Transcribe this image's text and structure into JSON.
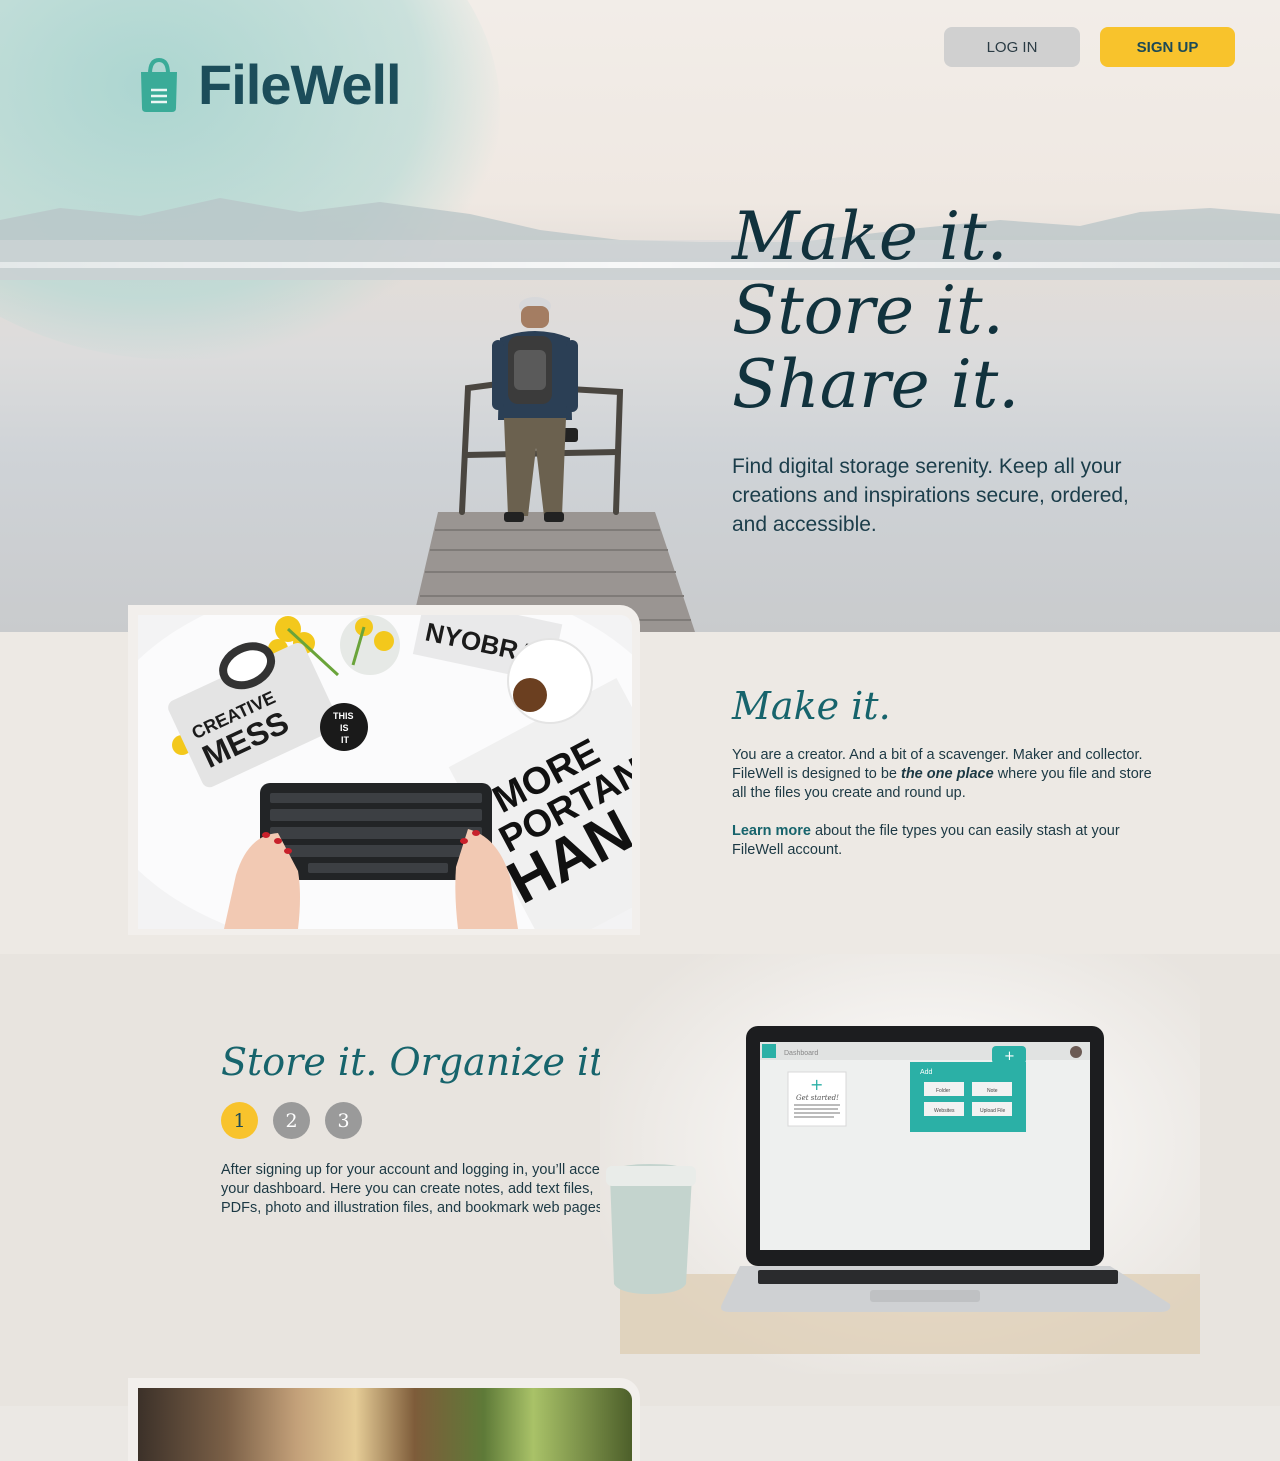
{
  "header": {
    "brand": "FileWell",
    "login_label": "LOG IN",
    "signup_label": "SIGN UP"
  },
  "hero": {
    "tagline": [
      "Make it.",
      "Store it.",
      "Share it."
    ],
    "subtitle": "Find digital storage serenity. Keep all your creations and inspirations secure, ordered, and accessible."
  },
  "make_section": {
    "heading": "Make it.",
    "para1_a": "You are a creator. And a bit of a scavenger. Maker and collector. FileWell is designed to be ",
    "para1_em": "the one place",
    "para1_b": " where you file and store all the files you create and round up.",
    "learn_more": "Learn more",
    "para2_rest": " about the file types you can easily stash at your FileWell account."
  },
  "desk_photo": {
    "mug_text": [
      "CREATIVE",
      "MESS"
    ],
    "sticker_text": [
      "THIS",
      "IS",
      "IT"
    ],
    "poster_text": [
      "MORE",
      "PORTANT",
      "HAN"
    ],
    "newspaper_text": "NYOBRA"
  },
  "store_section": {
    "heading": "Store it. Organize it.",
    "steps": [
      "1",
      "2",
      "3"
    ],
    "active_step": 1,
    "description": "After signing up for your account and logging in, you’ll access your dashboard. Here you can create notes, add text files, PDFs, photo and illustration files, and bookmark web pages."
  },
  "laptop_screen": {
    "topbar_label": "Dashboard",
    "card_title": "Get started!",
    "card_text": "Click the plus sign to begin saving and storing your photos, websites and text documents.",
    "add_menu_title": "Add",
    "add_options": [
      "Folder",
      "Note",
      "Websites",
      "Upload File"
    ]
  },
  "colors": {
    "brand_teal": "#17646c",
    "logo_teal": "#3aab98",
    "brand_dark": "#1c4d5a",
    "accent_yellow": "#f8c32c",
    "inactive_step": "#9a9a9a"
  }
}
